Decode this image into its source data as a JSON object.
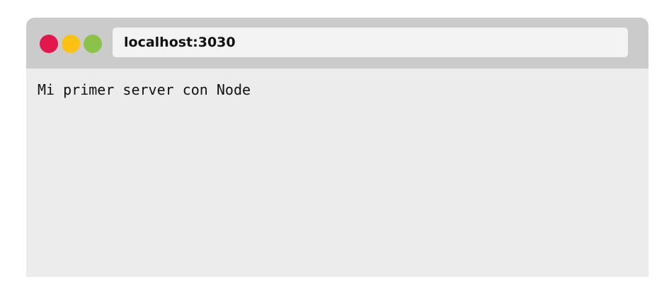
{
  "browser": {
    "address": "localhost:3030",
    "controls": {
      "close_color": "#e5164b",
      "minimize_color": "#fdc112",
      "zoom_color": "#8bc34a"
    }
  },
  "page": {
    "body_text": "Mi primer server con Node"
  }
}
